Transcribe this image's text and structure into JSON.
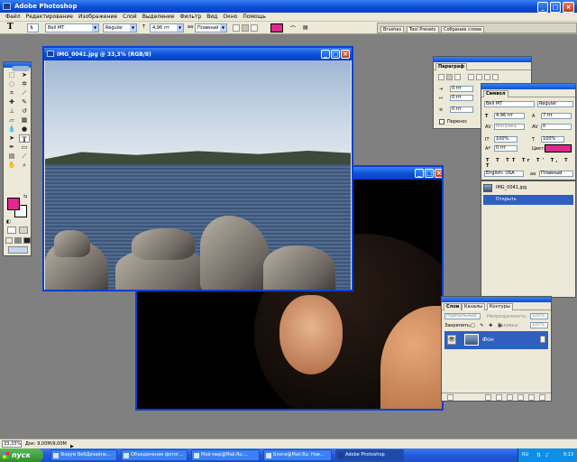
{
  "app": {
    "title": "Adobe Photoshop"
  },
  "menu": [
    "Файл",
    "Редактирование",
    "Изображение",
    "Слой",
    "Выделение",
    "Фильтр",
    "Вид",
    "Окно",
    "Помощь"
  ],
  "options_bar": {
    "font_family": "Bell MT",
    "font_style": "Regular",
    "font_size": "4,96 пт",
    "antialias": "Плавный",
    "color": "#e0288f",
    "tabs": [
      "Brushes",
      "Tool Presets",
      "Собрание слоев"
    ]
  },
  "toolbox": {
    "fg_color": "#e0288f",
    "bg_color": "#ffffff"
  },
  "doc1": {
    "title": "IMG_0041.jpg @ 33,3% (RGB/8)"
  },
  "doc2": {
    "title": ""
  },
  "paragraph_panel": {
    "tab": "Параграф",
    "fields": [
      "0 пт",
      "0 пт",
      "0 пт",
      "0 пт",
      "0 пт"
    ],
    "hyphenation": "Перенос"
  },
  "symbol_panel": {
    "tab": "Символ",
    "font_family": "Bell MT",
    "font_style": "Regular",
    "font_size": "4,96 пт",
    "leading": "7 пт",
    "kerning": "Метрика",
    "tracking": "0",
    "vscale": "100%",
    "hscale": "100%",
    "baseline": "0 пт",
    "color_label": "Цвет:",
    "color": "#e0288f",
    "language": "English: USA",
    "aa": "Плавный"
  },
  "history_panel": {
    "snapshot": "IMG_0041.jpg",
    "state": "Открыть"
  },
  "layers_panel": {
    "tabs": [
      "Слои",
      "Каналы",
      "Контуры"
    ],
    "blend_mode": "Нормальный",
    "opacity_label": "Непрозрачность:",
    "opacity": "100%",
    "lock_label": "Закрепить:",
    "fill_label": "Заливка:",
    "fill": "100%",
    "layer_name": "Фон"
  },
  "status": {
    "zoom": "33,33%",
    "doc_size": "Док: 9,00M/9,00M"
  },
  "taskbar": {
    "start": "пуск",
    "tasks": [
      "Форум ВебДизайне...",
      "Объединение фотог...",
      "Мой мир@Mail.Ru:...",
      "Блоги@Mail.Ru: Нов...",
      "Adobe Photoshop"
    ],
    "lang": "RU",
    "time": "9:13"
  }
}
